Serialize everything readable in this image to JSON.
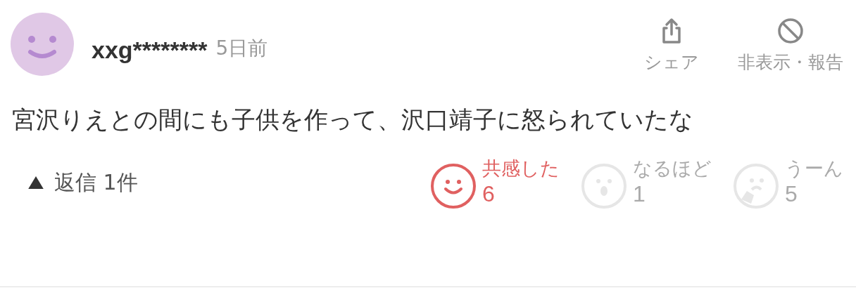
{
  "comment": {
    "user": "xxg********",
    "time": "5日前",
    "body": "宮沢りえとの間にも子供を作って、沢口靖子に怒られていたな"
  },
  "actions": [
    {
      "kind": "share",
      "label": "シェア"
    },
    {
      "kind": "hide",
      "label": "非表示・報告"
    }
  ],
  "replies": {
    "label": "返信 1件",
    "expanded": true
  },
  "reactions": [
    {
      "kind": "smile",
      "label": "共感した",
      "count": "6",
      "selected": true
    },
    {
      "kind": "surprised",
      "label": "なるほど",
      "count": "1",
      "selected": false
    },
    {
      "kind": "thinking",
      "label": "うーん",
      "count": "5",
      "selected": false
    }
  ]
}
